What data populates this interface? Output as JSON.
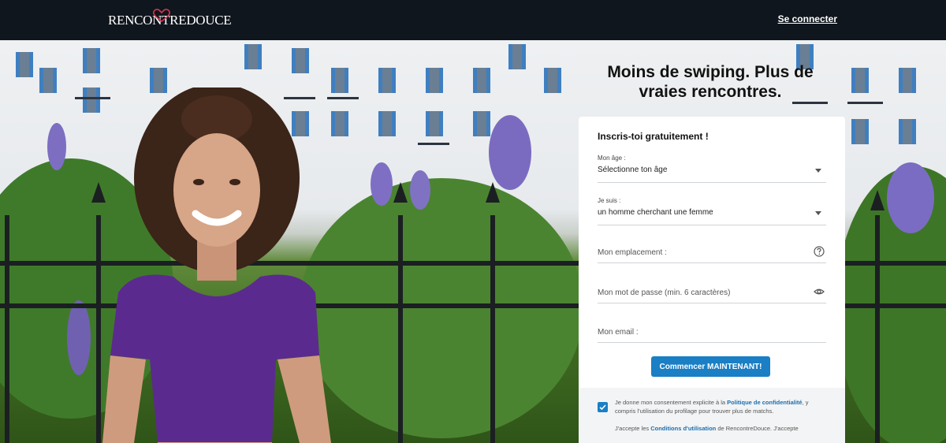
{
  "header": {
    "logo_left": "RENCONTRE",
    "logo_right": "DOUCE",
    "login_link": "Se connecter"
  },
  "hero": {
    "headline": "Moins de swiping. Plus de vraies rencontres."
  },
  "form": {
    "title": "Inscris-toi gratuitement !",
    "age_label": "Mon âge :",
    "age_value": "Sélectionne ton âge",
    "iam_label": "Je suis :",
    "iam_value": "un homme cherchant une femme",
    "location_placeholder": "Mon emplacement :",
    "password_placeholder": "Mon mot de passe (min. 6 caractères)",
    "email_placeholder": "Mon email :",
    "submit_label": "Commencer MAINTENANT!",
    "consent_prefix": "Je donne mon consentement explicite à la ",
    "consent_link": "Politique de confidentialité",
    "consent_suffix": ", y compris l’utilisation du profilage pour trouver plus de matchs.",
    "accept_prefix": "J'accepte les ",
    "accept_link": "Conditions d'utilisation",
    "accept_suffix": " de RencontreDouce. J'accepte"
  },
  "colors": {
    "header_bg": "#0f161d",
    "accent_blue": "#1a7fc4",
    "top_purple": "#5b2a8e",
    "logo_heart": "#d8364f"
  },
  "icons": {
    "location_help": "question-circle-icon",
    "password_toggle": "eye-icon",
    "dropdown": "caret-down-icon",
    "checkbox": "checkbox-checked-icon"
  }
}
